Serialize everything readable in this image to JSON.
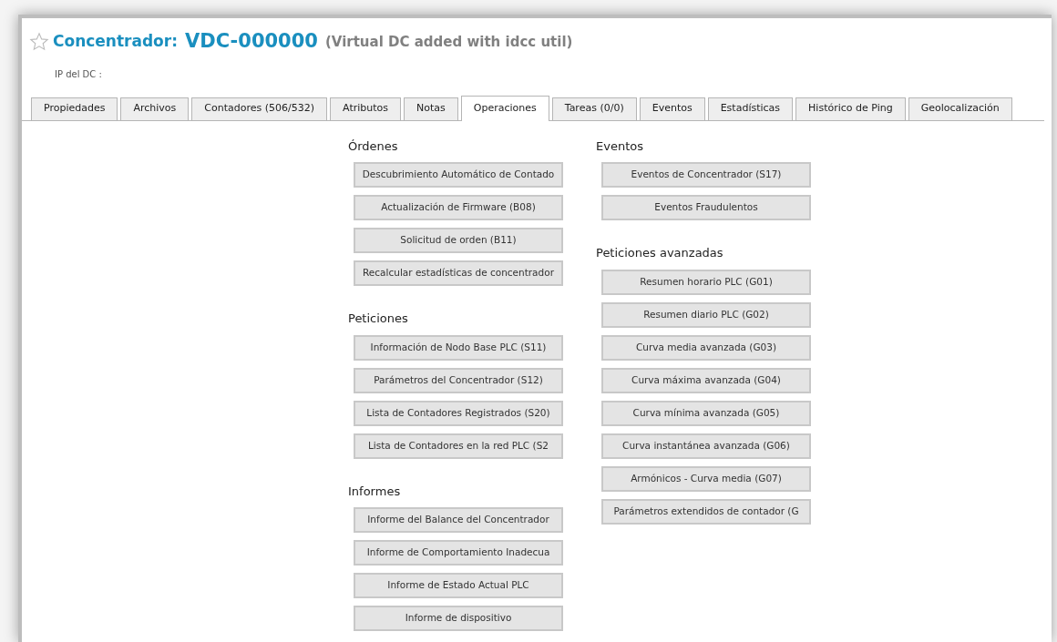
{
  "header": {
    "favorite": false,
    "label": "Concentrador:",
    "id": "VDC-000000",
    "note": "(Virtual DC added with idcc util)",
    "ip_label": "IP del DC :"
  },
  "tabs": [
    {
      "label": "Propiedades",
      "selected": false
    },
    {
      "label": "Archivos",
      "selected": false
    },
    {
      "label": "Contadores (506/532)",
      "selected": false
    },
    {
      "label": "Atributos",
      "selected": false
    },
    {
      "label": "Notas",
      "selected": false
    },
    {
      "label": "Operaciones",
      "selected": true
    },
    {
      "label": "Tareas (0/0)",
      "selected": false
    },
    {
      "label": "Eventos",
      "selected": false
    },
    {
      "label": "Estadísticas",
      "selected": false
    },
    {
      "label": "Histórico de Ping",
      "selected": false
    },
    {
      "label": "Geolocalización",
      "selected": false
    }
  ],
  "columns": [
    [
      {
        "heading": "Órdenes",
        "buttons": [
          "Descubrimiento Automático de Contado",
          "Actualización de Firmware (B08)",
          "Solicitud de orden (B11)",
          "Recalcular estadísticas de concentrador"
        ]
      },
      {
        "heading": "Peticiones",
        "buttons": [
          "Información de Nodo Base PLC (S11)",
          "Parámetros del Concentrador (S12)",
          "Lista de Contadores Registrados (S20)",
          "Lista de Contadores en la red PLC (S2"
        ]
      },
      {
        "heading": "Informes",
        "buttons": [
          "Informe del Balance del Concentrador",
          "Informe de Comportamiento Inadecua",
          "Informe de Estado Actual PLC",
          "Informe de dispositivo"
        ]
      }
    ],
    [
      {
        "heading": "Eventos",
        "buttons": [
          "Eventos de Concentrador (S17)",
          "Eventos Fraudulentos"
        ]
      },
      {
        "heading": "Peticiones avanzadas",
        "buttons": [
          "Resumen horario PLC (G01)",
          "Resumen diario PLC (G02)",
          "Curva media avanzada (G03)",
          "Curva máxima avanzada (G04)",
          "Curva mínima avanzada (G05)",
          "Curva instantánea avanzada (G06)",
          "Armónicos - Curva media (G07)",
          "Parámetros extendidos de contador (G"
        ]
      }
    ]
  ]
}
